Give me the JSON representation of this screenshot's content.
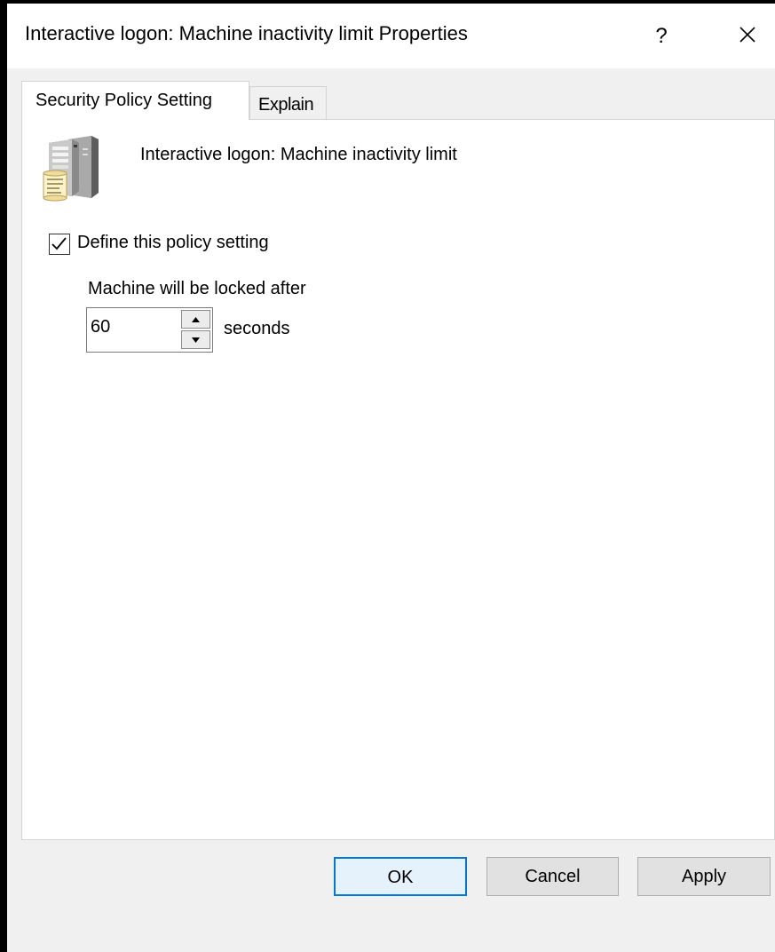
{
  "window": {
    "title": "Interactive logon: Machine inactivity limit Properties",
    "help_glyph": "?",
    "close_icon": "close-icon"
  },
  "tabs": [
    {
      "label": "Security Policy Setting",
      "selected": true
    },
    {
      "label": "Explain",
      "selected": false
    }
  ],
  "policy": {
    "icon": "server-policy-icon",
    "name": "Interactive logon: Machine inactivity limit",
    "define_checkbox": {
      "label": "Define this policy setting",
      "checked": true
    },
    "lock_label": "Machine will be locked after",
    "timeout_value": "60",
    "unit": "seconds"
  },
  "buttons": {
    "ok": "OK",
    "cancel": "Cancel",
    "apply": "Apply"
  },
  "colors": {
    "accent": "#0078d7",
    "dialog_bg": "#f0f0f0",
    "panel_bg": "#ffffff"
  }
}
